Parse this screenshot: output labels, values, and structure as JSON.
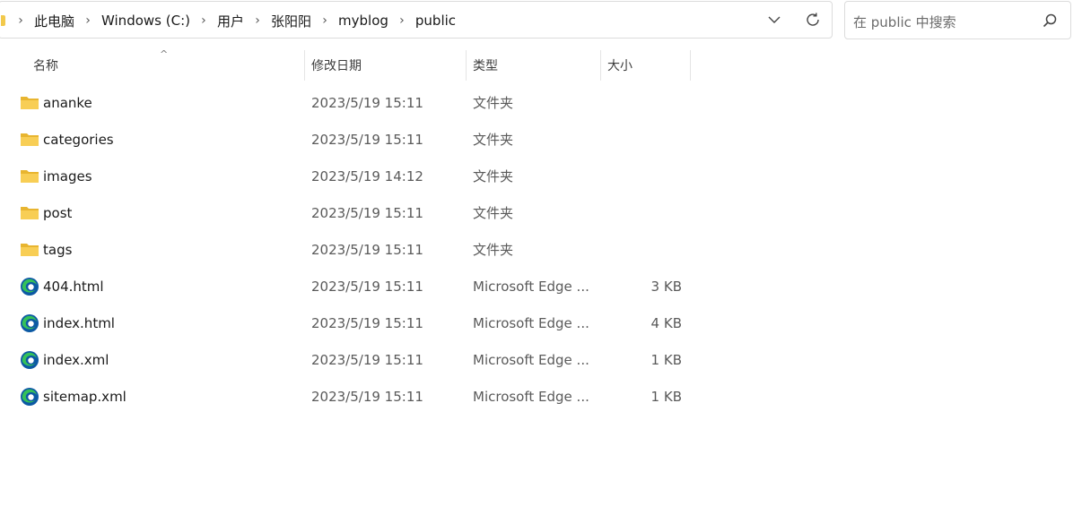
{
  "breadcrumb": {
    "items": [
      "此电脑",
      "Windows (C:)",
      "用户",
      "张阳阳",
      "myblog",
      "public"
    ],
    "separator": "›"
  },
  "address_controls": {
    "dropdown_icon": "chevron-down-icon",
    "refresh_icon": "refresh-icon"
  },
  "search": {
    "placeholder": "在 public 中搜索",
    "icon": "search-icon"
  },
  "columns": {
    "name": "名称",
    "date": "修改日期",
    "type": "类型",
    "size": "大小",
    "sort_indicator": "^"
  },
  "files": [
    {
      "name": "ananke",
      "date": "2023/5/19 15:11",
      "type": "文件夹",
      "size": "",
      "icon": "folder-icon"
    },
    {
      "name": "categories",
      "date": "2023/5/19 15:11",
      "type": "文件夹",
      "size": "",
      "icon": "folder-icon"
    },
    {
      "name": "images",
      "date": "2023/5/19 14:12",
      "type": "文件夹",
      "size": "",
      "icon": "folder-icon"
    },
    {
      "name": "post",
      "date": "2023/5/19 15:11",
      "type": "文件夹",
      "size": "",
      "icon": "folder-icon"
    },
    {
      "name": "tags",
      "date": "2023/5/19 15:11",
      "type": "文件夹",
      "size": "",
      "icon": "folder-icon"
    },
    {
      "name": "404.html",
      "date": "2023/5/19 15:11",
      "type": "Microsoft Edge ...",
      "size": "3 KB",
      "icon": "edge-icon"
    },
    {
      "name": "index.html",
      "date": "2023/5/19 15:11",
      "type": "Microsoft Edge ...",
      "size": "4 KB",
      "icon": "edge-icon"
    },
    {
      "name": "index.xml",
      "date": "2023/5/19 15:11",
      "type": "Microsoft Edge ...",
      "size": "1 KB",
      "icon": "edge-icon"
    },
    {
      "name": "sitemap.xml",
      "date": "2023/5/19 15:11",
      "type": "Microsoft Edge ...",
      "size": "1 KB",
      "icon": "edge-icon"
    }
  ],
  "colors": {
    "folder": "#F4C542",
    "edge_blue": "#0C59A4",
    "edge_green": "#35C159"
  }
}
